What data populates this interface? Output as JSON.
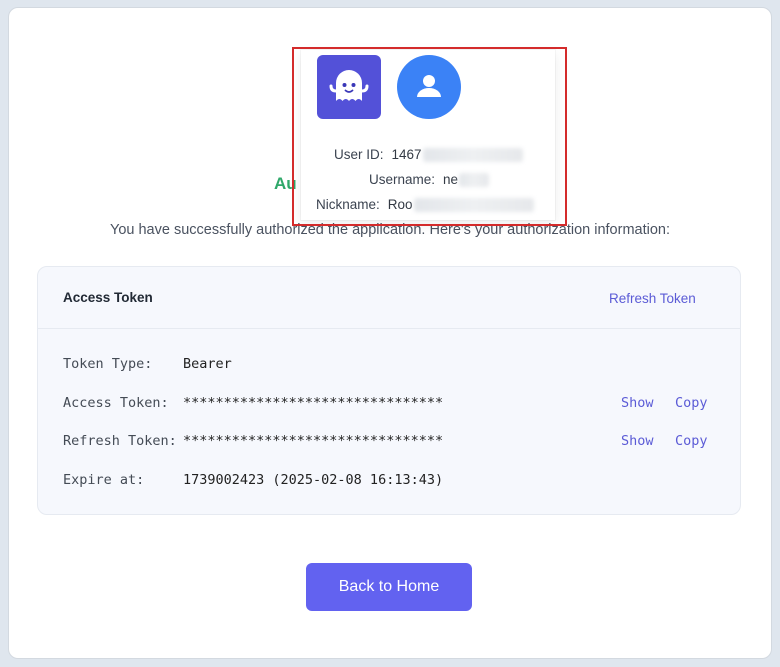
{
  "popup": {
    "app_logo_icon": "ghost-icon",
    "user_avatar_icon": "user-icon",
    "fields": [
      {
        "label": "User ID:",
        "value": "1467"
      },
      {
        "label": "Username:",
        "value": "ne"
      },
      {
        "label": "Nickname:",
        "value": "Roo"
      }
    ]
  },
  "page": {
    "title_partial": "Au",
    "success_message": "You have successfully authorized the application. Here's your authorization information:"
  },
  "card": {
    "title": "Access Token",
    "refresh_link": "Refresh Token",
    "rows": [
      {
        "label": "Token Type:",
        "value": "Bearer"
      },
      {
        "label": "Access Token:",
        "value": "********************************",
        "show": "Show",
        "copy": "Copy"
      },
      {
        "label": "Refresh Token:",
        "value": "********************************",
        "show": "Show",
        "copy": "Copy"
      },
      {
        "label": "Expire at:",
        "value": "1739002423 (2025-02-08 16:13:43)"
      }
    ]
  },
  "home_button": "Back to Home",
  "colors": {
    "accent": "#6262f0",
    "link": "#5b5bd6",
    "success": "#2fa86a",
    "highlight": "#d42b2b",
    "app_logo_bg": "#5351d8",
    "avatar_bg": "#3b82f6"
  }
}
